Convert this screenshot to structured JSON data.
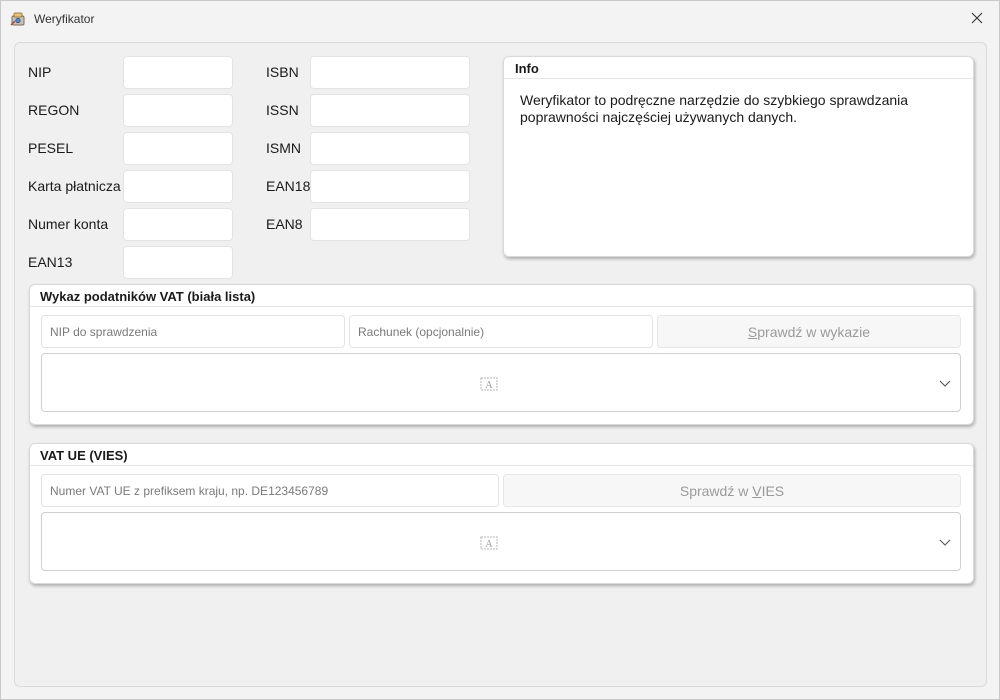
{
  "window": {
    "title": "Weryfikator"
  },
  "fields": {
    "left": [
      {
        "label": "NIP",
        "value": ""
      },
      {
        "label": "REGON",
        "value": ""
      },
      {
        "label": "PESEL",
        "value": ""
      },
      {
        "label": "Karta płatnicza",
        "value": ""
      },
      {
        "label": "Numer konta",
        "value": ""
      },
      {
        "label": "EAN13",
        "value": ""
      }
    ],
    "right": [
      {
        "label": "ISBN",
        "value": ""
      },
      {
        "label": "ISSN",
        "value": ""
      },
      {
        "label": "ISMN",
        "value": ""
      },
      {
        "label": "EAN18",
        "value": ""
      },
      {
        "label": "EAN8",
        "value": ""
      }
    ]
  },
  "info": {
    "title": "Info",
    "line1": "Weryfikator to podręczne narzędzie do szybkiego sprawdzania",
    "line2": "poprawności najczęściej używanych danych."
  },
  "vat_whitelist": {
    "title": "Wykaz podatników VAT (biała lista)",
    "nip_placeholder": "NIP do sprawdzenia",
    "account_placeholder": "Rachunek (opcjonalnie)",
    "button_mnemonic": "S",
    "button_rest": "prawdź w wykazie",
    "result_value": ""
  },
  "vies": {
    "title": "VAT UE (VIES)",
    "vat_placeholder": "Numer VAT UE z prefiksem kraju, np. DE123456789",
    "button_before": "Sprawdź w ",
    "button_mnemonic": "V",
    "button_after": "IES",
    "result_value": ""
  },
  "colors": {
    "window_bg": "#f3f3f3",
    "panel_bg": "#ffffff",
    "disabled_text": "#9a9a9a"
  }
}
